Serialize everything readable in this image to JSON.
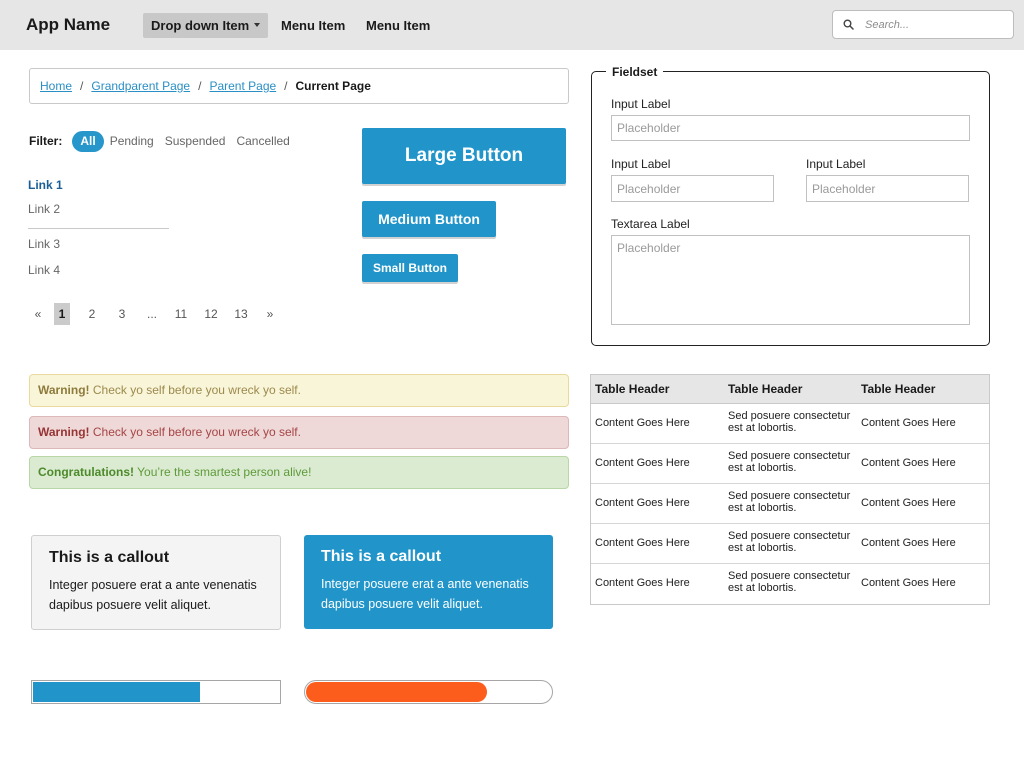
{
  "header": {
    "app_name": "App Name",
    "dropdown_label": "Drop down Item",
    "menu_items": [
      "Menu Item",
      "Menu Item"
    ],
    "search_placeholder": "Search..."
  },
  "breadcrumb": {
    "items": [
      "Home",
      "Grandparent Page",
      "Parent Page"
    ],
    "separator": "/",
    "current": "Current Page"
  },
  "filter": {
    "label": "Filter:",
    "options": [
      "All",
      "Pending",
      "Suspended",
      "Cancelled"
    ],
    "selected": "All"
  },
  "links": {
    "group1": [
      "Link 1",
      "Link 2"
    ],
    "group2": [
      "Link 3",
      "Link 4"
    ],
    "active": "Link 1"
  },
  "pagination": {
    "prev": "«",
    "pages": [
      "1",
      "2",
      "3",
      "...",
      "11",
      "12",
      "13"
    ],
    "current": "1",
    "next": "»"
  },
  "buttons": {
    "large": "Large Button",
    "medium": "Medium Button",
    "small": "Small Button"
  },
  "fieldset": {
    "legend": "Fieldset",
    "fields": [
      {
        "label": "Input Label",
        "placeholder": "Placeholder"
      },
      {
        "label": "Input Label",
        "placeholder": "Placeholder"
      },
      {
        "label": "Input Label",
        "placeholder": "Placeholder"
      }
    ],
    "textarea": {
      "label": "Textarea Label",
      "placeholder": "Placeholder"
    }
  },
  "alerts": {
    "warning": {
      "strong": "Warning!",
      "text": " Check yo self before you wreck yo self."
    },
    "danger": {
      "strong": "Warning!",
      "text": " Check yo self before you wreck yo self."
    },
    "success": {
      "strong": "Congratulations!",
      "text": " You’re the smartest person alive!"
    }
  },
  "table": {
    "headers": [
      "Table Header",
      "Table Header",
      "Table Header"
    ],
    "rows": [
      [
        "Content Goes Here",
        "Sed posuere consectetur est at lobortis.",
        "Content Goes Here"
      ],
      [
        "Content Goes Here",
        "Sed posuere consectetur est at lobortis.",
        "Content Goes Here"
      ],
      [
        "Content Goes Here",
        "Sed posuere consectetur est at lobortis.",
        "Content Goes Here"
      ],
      [
        "Content Goes Here",
        "Sed posuere consectetur est at lobortis.",
        "Content Goes Here"
      ],
      [
        "Content Goes Here",
        "Sed posuere consectetur est at lobortis.",
        "Content Goes Here"
      ]
    ]
  },
  "callouts": {
    "light": {
      "title": "This is a callout",
      "body": "Integer posuere erat a ante venenatis dapibus posuere velit aliquet."
    },
    "blue": {
      "title": "This is a callout",
      "body": "Integer posuere erat a ante venenatis dapibus posuere velit aliquet."
    }
  },
  "progress": {
    "square_fraction": 0.68,
    "rounded_fraction": 0.74
  },
  "colors": {
    "accent": "#2195c9",
    "progress_orange": "#fc5d1d",
    "topbar_bg": "#e6e6e6"
  },
  "icons": {
    "search": "search-icon",
    "caret": "caret-down-icon"
  }
}
